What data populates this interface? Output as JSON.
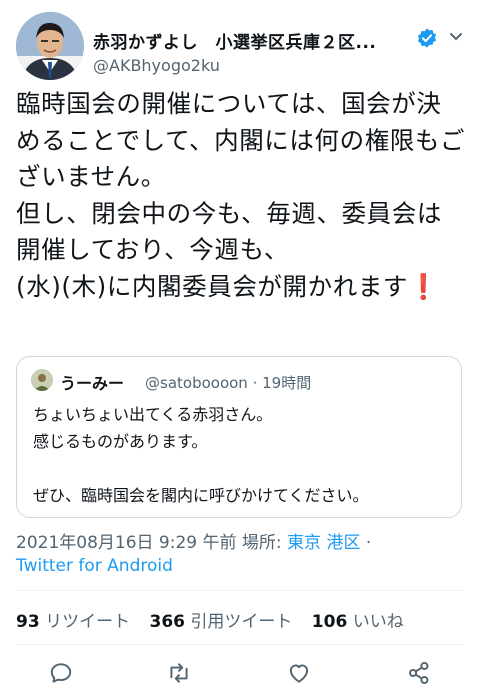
{
  "author": {
    "name": "赤羽かずよし　小選挙区兵庫２区...",
    "handle": "@AKBhyogo2ku"
  },
  "tweet": {
    "text": "臨時国会の開催については、国会が決めることでして、内閣には何の権限もございません。\n但し、閉会中の今も、毎週、委員会は開催しており、今週も、\n(水)(木)に内閣委員会が開かれます",
    "emoji": "❗"
  },
  "quoted": {
    "name": "うーみー",
    "handle": "@satoboooon",
    "time": "· 19時間",
    "text": "ちょいちょい出てくる赤羽さん。\n感じるものがあります。\n\nぜひ、臨時国会を閣内に呼びかけてください。"
  },
  "meta": {
    "timestamp": "2021年08月16日 9:29 午前",
    "place_label": "場所:",
    "place": "東京 港区",
    "sep": "·",
    "source": "Twitter for Android"
  },
  "stats": {
    "retweets": "93",
    "retweets_label": "リツイート",
    "quotes": "366",
    "quotes_label": "引用ツイート",
    "likes": "106",
    "likes_label": "いいね"
  },
  "icons": {
    "verified": "verified-badge-icon",
    "more": "chevron-down-icon",
    "reply": "reply-icon",
    "retweet": "retweet-icon",
    "like": "heart-icon",
    "share": "share-icon"
  },
  "colors": {
    "accent": "#1d9bf0",
    "text": "#0f1419",
    "muted": "#536471",
    "border": "#cfd9de"
  }
}
